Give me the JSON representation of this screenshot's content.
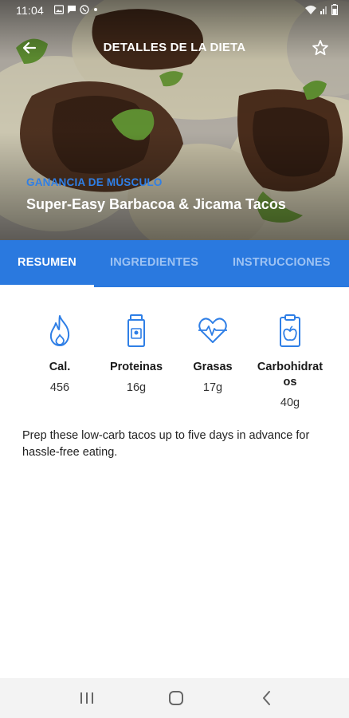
{
  "status_bar": {
    "time": "11:04"
  },
  "app_bar": {
    "title": "DETALLES DE LA DIETA"
  },
  "recipe": {
    "category": "GANANCIA DE MÚSCULO",
    "title": "Super-Easy Barbacoa & Jicama Tacos",
    "description": "Prep these low-carb tacos up to five days in advance for hassle-free eating."
  },
  "tabs": [
    {
      "label": "RESUMEN",
      "active": true
    },
    {
      "label": "INGREDIENTES",
      "active": false
    },
    {
      "label": "INSTRUCCIONES",
      "active": false
    }
  ],
  "nutrition": [
    {
      "icon": "flame-icon",
      "label": "Cal.",
      "value": "456"
    },
    {
      "icon": "protein-jar-icon",
      "label": "Proteinas",
      "value": "16g"
    },
    {
      "icon": "heart-pulse-icon",
      "label": "Grasas",
      "value": "17g"
    },
    {
      "icon": "clipboard-apple-icon",
      "label": "Carbohidratos",
      "value": "40g"
    }
  ],
  "colors": {
    "primary": "#2a79df",
    "accent_text": "#2f7fe6",
    "tab_inactive": "#9ec3f3",
    "icon_blue": "#2f7fe6"
  }
}
